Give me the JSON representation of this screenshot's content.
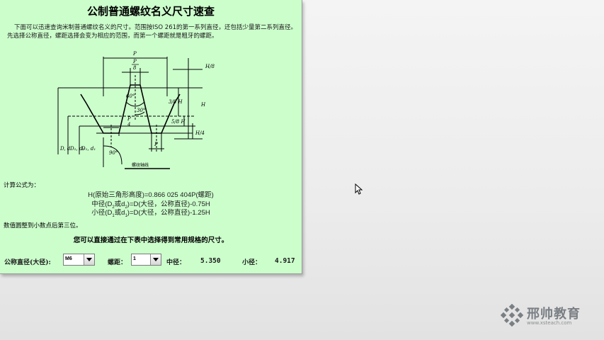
{
  "panel": {
    "title": "公制普通螺纹名义尺寸速查",
    "intro": "下面可以迅速查询米制普通螺纹名义的尺寸。范围按ISO 261的第一系列直径，还包括少量第二系列直径。先选择公称直径，螺距选择会变为相应的范围，而第一个螺距就是粗牙的螺距。",
    "diagram": {
      "label_P": "P",
      "label_P_8": "P",
      "label_8": "8",
      "label_P_4": "P",
      "label_4": "4",
      "label_H_8_top": "H/8",
      "label_3_8H": "3/8 H",
      "label_5_8H": "5/8 H",
      "label_H": "H",
      "label_H_4": "H/4",
      "label_60": "60°",
      "label_30": "30°",
      "label_90": "90°",
      "label_D_d": "D, d",
      "label_D2_d2": "D₂, d₂",
      "label_D1_d1": "D₁, d₁",
      "label_axis": "螺纹轴线"
    },
    "formula_heading": "计算公式为：",
    "formula_1": "H(原始三角形高度)=0.866 025 404P(螺距)",
    "formula_2_a": "中径(D",
    "formula_2_s1": "2",
    "formula_2_b": "或d",
    "formula_2_s2": "2",
    "formula_2_c": ")=D(大径，公称直径)-0.75H",
    "formula_3_a": "小径(D",
    "formula_3_s1": "1",
    "formula_3_b": "或d",
    "formula_3_s2": "1",
    "formula_3_c": ")=D(大径，公称直径)-1.25H",
    "rounding_note": "数值圆整到小数点后第三位。",
    "hint": "您可以直接通过在下表中选择得到常用规格的尺寸。",
    "nominal_label": "公称直径(大径):",
    "nominal_value": "M6",
    "pitch_label": "螺距：",
    "pitch_value": "1",
    "pitch_diameter_label": "中径：",
    "pitch_diameter_value": "5.350",
    "minor_diameter_label": "小径：",
    "minor_diameter_value": "4.917"
  },
  "watermark": {
    "name": "邢帅教育",
    "url": "www.xsteach.com"
  },
  "colors": {
    "panel_bg": "#ccfecc",
    "watermark": "#7a7f84"
  }
}
